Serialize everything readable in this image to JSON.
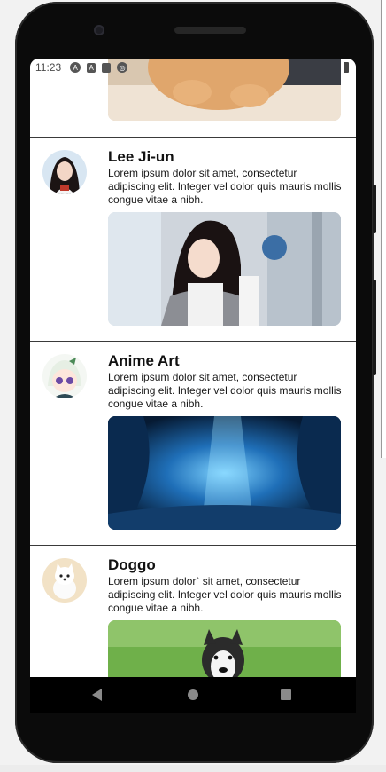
{
  "status_bar": {
    "time": "11:23",
    "icons": [
      "android-a-icon",
      "a-square-icon",
      "sd-card-icon",
      "cast-circle-icon",
      "battery-icon"
    ]
  },
  "cards": [
    {
      "title": "",
      "description": "",
      "avatar_icon": "",
      "photo_icon": "cat-photo"
    },
    {
      "title": "Lee Ji-un",
      "description": "Lorem ipsum dolor sit amet, consectetur adipiscing elit. Integer vel dolor quis mauris mollis congue vitae a nibh.",
      "avatar_icon": "woman-portrait-avatar",
      "photo_icon": "woman-photo"
    },
    {
      "title": "Anime Art",
      "description": "Lorem ipsum dolor sit amet, consectetur adipiscing elit. Integer vel dolor quis mauris mollis congue vitae a nibh.",
      "avatar_icon": "anime-character-avatar",
      "photo_icon": "blue-forest-photo"
    },
    {
      "title": "Doggo",
      "description": "Lorem ipsum dolor` sit amet, consectetur adipiscing elit. Integer vel dolor quis mauris mollis congue vitae a nibh.",
      "avatar_icon": "white-dog-avatar",
      "photo_icon": "husky-on-grass-photo"
    }
  ],
  "nav_bar": {
    "buttons": [
      "back-icon",
      "home-icon",
      "recents-icon"
    ]
  },
  "colors": {
    "divider": "#3a3a3a",
    "phone_body": "#0b0b0b",
    "text": "#111111"
  }
}
